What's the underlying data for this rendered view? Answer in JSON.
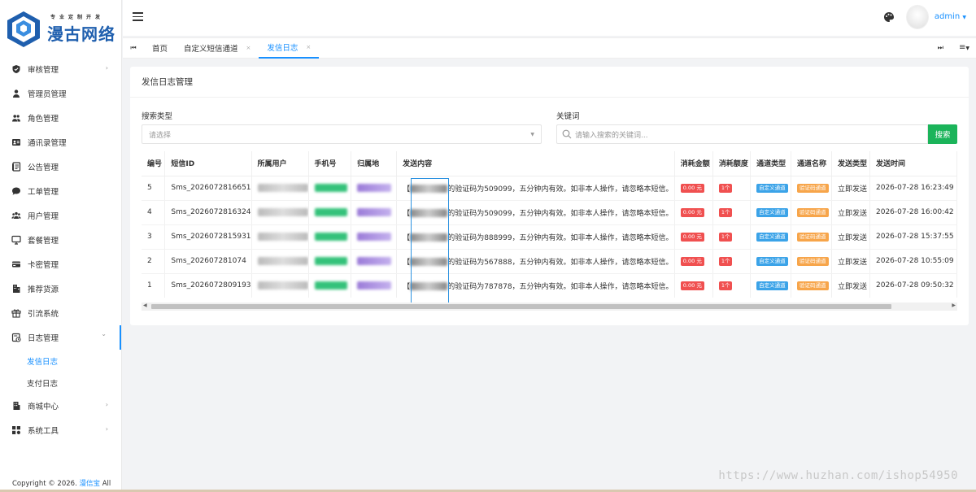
{
  "brand": {
    "slogan": "专业定制开发",
    "name": "漫古网络"
  },
  "sidebar": {
    "items": [
      {
        "label": "审核管理",
        "icon": "shield-check-icon",
        "has_arrow": true
      },
      {
        "label": "管理员管理",
        "icon": "person-icon",
        "has_arrow": false
      },
      {
        "label": "角色管理",
        "icon": "people-icon",
        "has_arrow": false
      },
      {
        "label": "通讯录管理",
        "icon": "contact-card-icon",
        "has_arrow": false
      },
      {
        "label": "公告管理",
        "icon": "notice-icon",
        "has_arrow": false
      },
      {
        "label": "工单管理",
        "icon": "chat-bubble-icon",
        "has_arrow": false
      },
      {
        "label": "用户管理",
        "icon": "users-group-icon",
        "has_arrow": false
      },
      {
        "label": "套餐管理",
        "icon": "package-icon",
        "has_arrow": false
      },
      {
        "label": "卡密管理",
        "icon": "card-icon",
        "has_arrow": false
      },
      {
        "label": "推荐货源",
        "icon": "building-icon",
        "has_arrow": false
      },
      {
        "label": "引流系统",
        "icon": "gift-icon",
        "has_arrow": false
      },
      {
        "label": "日志管理",
        "icon": "log-icon",
        "has_arrow": true,
        "open": true
      }
    ],
    "submenu": [
      {
        "label": "发信日志",
        "active": true
      },
      {
        "label": "支付日志",
        "active": false
      }
    ],
    "after_items": [
      {
        "label": "商城中心",
        "icon": "shop-icon",
        "has_arrow": true
      },
      {
        "label": "系统工具",
        "icon": "tools-grid-icon",
        "has_arrow": true
      }
    ],
    "copyright_prefix": "Copyright © 2026.",
    "copyright_brand": "漫信宝",
    "copyright_suffix": "All"
  },
  "header": {
    "user_name": "admin"
  },
  "tabs": [
    {
      "label": "首页",
      "closable": false,
      "active": false
    },
    {
      "label": "自定义短信通道",
      "closable": true,
      "active": false
    },
    {
      "label": "发信日志",
      "closable": true,
      "active": true
    }
  ],
  "card": {
    "title": "发信日志管理",
    "search_type_label": "搜索类型",
    "search_type_placeholder": "请选择",
    "keyword_label": "关键词",
    "keyword_placeholder": "请输入搜索的关键词...",
    "search_button": "搜索"
  },
  "table": {
    "columns": [
      "编号",
      "短信ID",
      "所属用户",
      "手机号",
      "归属地",
      "发送内容",
      "消耗金额",
      "消耗额度",
      "通道类型",
      "通道名称",
      "发送类型",
      "发送时间"
    ],
    "rows": [
      {
        "id": "5",
        "sms_id": "Sms_2026072816651",
        "content_prefix": "【",
        "content_suffix": "的验证码为509099，五分钟内有效。如非本人操作，请忽略本短信。",
        "amount": "0.00 元",
        "quota": "1个",
        "channel_type": "自定义通道",
        "channel_name": "验证码通道",
        "send_type": "立即发送",
        "time": "2026-07-28 16:23:49"
      },
      {
        "id": "4",
        "sms_id": "Sms_2026072816324",
        "content_prefix": "【",
        "content_suffix": "的验证码为509099，五分钟内有效。如非本人操作，请忽略本短信。",
        "amount": "0.00 元",
        "quota": "1个",
        "channel_type": "自定义通道",
        "channel_name": "验证码通道",
        "send_type": "立即发送",
        "time": "2026-07-28 16:00:42"
      },
      {
        "id": "3",
        "sms_id": "Sms_2026072815931",
        "content_prefix": "【",
        "content_suffix": "的验证码为888999，五分钟内有效。如非本人操作，请忽略本短信。",
        "amount": "0.00 元",
        "quota": "1个",
        "channel_type": "自定义通道",
        "channel_name": "验证码通道",
        "send_type": "立即发送",
        "time": "2026-07-28 15:37:55"
      },
      {
        "id": "2",
        "sms_id": "Sms_202607281074",
        "content_prefix": "【",
        "content_suffix": "的验证码为567888，五分钟内有效。如非本人操作，请忽略本短信。",
        "amount": "0.00 元",
        "quota": "1个",
        "channel_type": "自定义通道",
        "channel_name": "验证码通道",
        "send_type": "立即发送",
        "time": "2026-07-28 10:55:09"
      },
      {
        "id": "1",
        "sms_id": "Sms_2026072809193",
        "content_prefix": "【",
        "content_suffix": "的验证码为787878，五分钟内有效。如非本人操作，请忽略本短信。",
        "amount": "0.00 元",
        "quota": "1个",
        "channel_type": "自定义通道",
        "channel_name": "验证码通道",
        "send_type": "立即发送",
        "time": "2026-07-28 09:50:32"
      }
    ]
  },
  "watermark": "https://www.huzhan.com/ishop54950",
  "colors": {
    "accent": "#1890ff",
    "search_button": "#1bb45a",
    "badge_red": "#f05050",
    "badge_blue": "#3ba3e8",
    "badge_orange": "#f7a54a"
  }
}
